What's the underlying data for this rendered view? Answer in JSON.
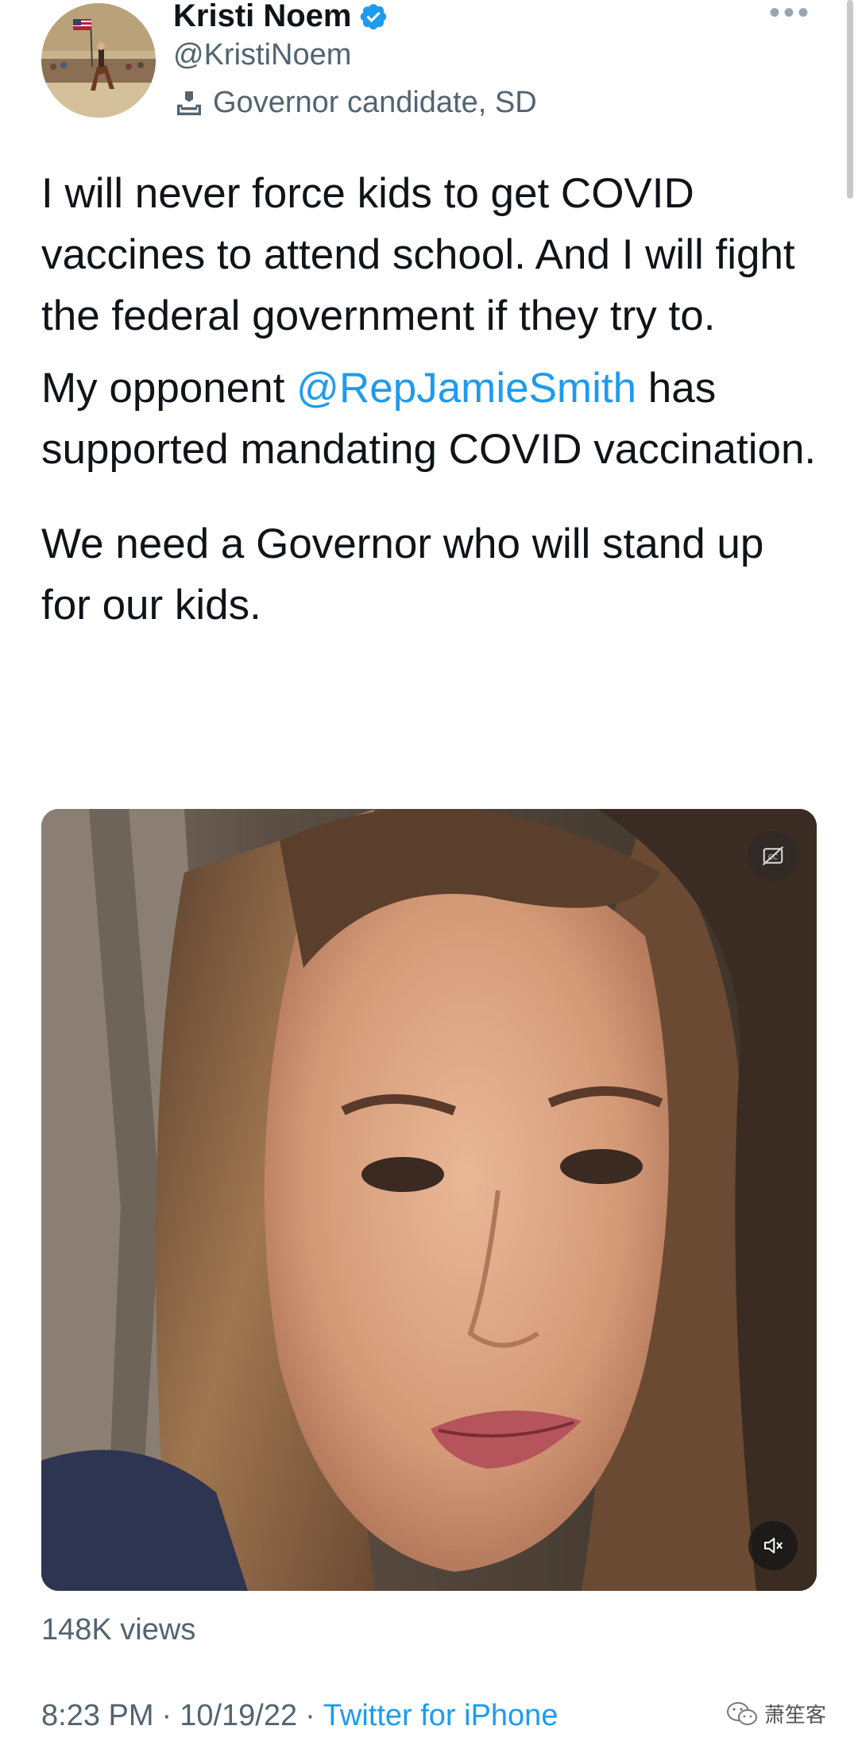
{
  "author": {
    "display_name": "Kristi Noem",
    "handle": "@KristiNoem",
    "affiliation": "Governor candidate, SD"
  },
  "icons": {
    "verified": "verified-badge-icon",
    "more": "more-icon",
    "affiliation": "ballot-box-icon",
    "captions": "closed-captions-icon",
    "mute": "muted-speaker-icon"
  },
  "more_label": "•••",
  "tweet": {
    "p1": "I will never force kids to get COVID vaccines to attend school. And I will fight the federal government if they try to.",
    "p2_before": "My opponent ",
    "p2_mention": "@RepJamieSmith",
    "p2_after": " has supported mandating COVID vaccination.",
    "p3": "We need a Governor who will stand up for our kids."
  },
  "views": "148K views",
  "meta": {
    "time": "8:23 PM",
    "date": "10/19/22",
    "separator": "·",
    "source": "Twitter for iPhone"
  },
  "watermark": "萧笙客",
  "colors": {
    "accent": "#1d9bf0",
    "secondary_text": "#536471",
    "primary_text": "#0f1419"
  }
}
